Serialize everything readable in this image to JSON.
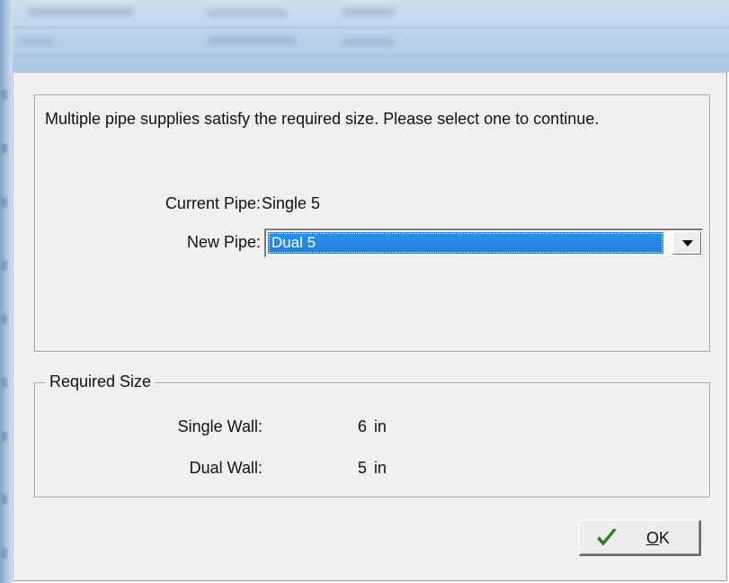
{
  "dialog": {
    "message": "Multiple pipe supplies satisfy the required size. Please select one to continue.",
    "current_pipe": {
      "label": "Current Pipe:",
      "value": "Single 5"
    },
    "new_pipe": {
      "label": "New Pipe:",
      "selected": "Dual 5"
    },
    "required_size": {
      "legend": "Required Size",
      "single_wall": {
        "label": "Single Wall:",
        "value": "6",
        "unit": "in"
      },
      "dual_wall": {
        "label": "Dual Wall:",
        "value": "5",
        "unit": "in"
      }
    },
    "ok_button": {
      "mnemonic": "O",
      "rest": "K",
      "icon": "checkmark-icon"
    }
  },
  "colors": {
    "dialog_bg": "#f0f0f0",
    "selection": "#1f7fdc",
    "check": "#2e8b1e"
  }
}
